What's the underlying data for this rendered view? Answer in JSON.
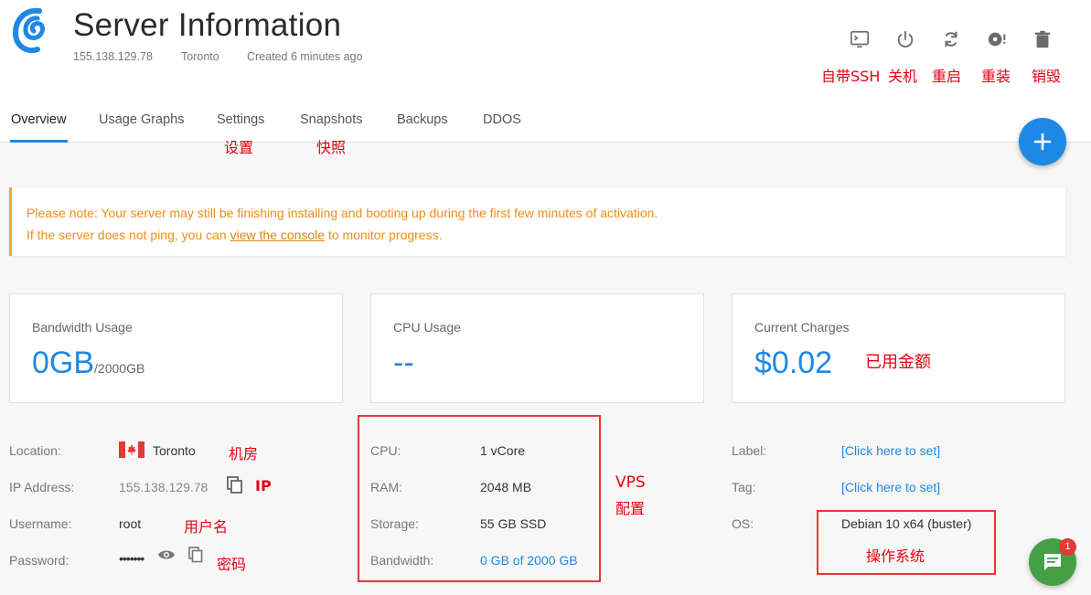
{
  "header": {
    "title": "Server Information",
    "ip": "155.138.129.78",
    "location": "Toronto",
    "created": "Created 6 minutes ago"
  },
  "actions": [
    {
      "icon": "console-icon",
      "annotation": "自带SSH"
    },
    {
      "icon": "power-icon",
      "annotation": "关机"
    },
    {
      "icon": "restart-icon",
      "annotation": "重启"
    },
    {
      "icon": "reinstall-icon",
      "annotation": "重装"
    },
    {
      "icon": "trash-icon",
      "annotation": "销毁"
    }
  ],
  "tabs": [
    {
      "label": "Overview",
      "annotation": ""
    },
    {
      "label": "Usage Graphs",
      "annotation": ""
    },
    {
      "label": "Settings",
      "annotation": "设置"
    },
    {
      "label": "Snapshots",
      "annotation": "快照"
    },
    {
      "label": "Backups",
      "annotation": ""
    },
    {
      "label": "DDOS",
      "annotation": ""
    }
  ],
  "notice": {
    "line1": "Please note: Your server may still be finishing installing and booting up during the first few minutes of activation.",
    "line2_pre": "If the server does not ping, you can ",
    "line2_link": "view the console",
    "line2_post": " to monitor progress."
  },
  "cards": {
    "bandwidth": {
      "label": "Bandwidth Usage",
      "value": "0GB",
      "unit": "/2000GB"
    },
    "cpu": {
      "label": "CPU Usage",
      "value": "--"
    },
    "charges": {
      "label": "Current Charges",
      "value": "$0.02",
      "annotation": "已用金额"
    }
  },
  "left_info": {
    "location_label": "Location:",
    "location_value": "Toronto",
    "location_ann": "机房",
    "ip_label": "IP Address:",
    "ip_value": "155.138.129.78",
    "ip_ann": "IP",
    "username_label": "Username:",
    "username_value": "root",
    "username_ann": "用户名",
    "password_label": "Password:",
    "password_value": "•••••••",
    "password_ann": "密码"
  },
  "mid_info": {
    "cpu_label": "CPU:",
    "cpu_value": "1 vCore",
    "ram_label": "RAM:",
    "ram_value": "2048 MB",
    "storage_label": "Storage:",
    "storage_value": "55 GB SSD",
    "bandwidth_label": "Bandwidth:",
    "bandwidth_value": "0 GB of 2000 GB",
    "ann_line1": "VPS",
    "ann_line2": "配置"
  },
  "right_info": {
    "label_label": "Label:",
    "label_value": "[Click here to set]",
    "tag_label": "Tag:",
    "tag_value": "[Click here to set]",
    "os_label": "OS:",
    "os_value": "Debian 10 x64 (buster)",
    "os_ann": "操作系统"
  },
  "chat": {
    "badge": "1"
  },
  "colors": {
    "accent": "#1e88e5",
    "annotation": "#e60012",
    "warning": "#f08c1a",
    "chat": "#43a047"
  }
}
